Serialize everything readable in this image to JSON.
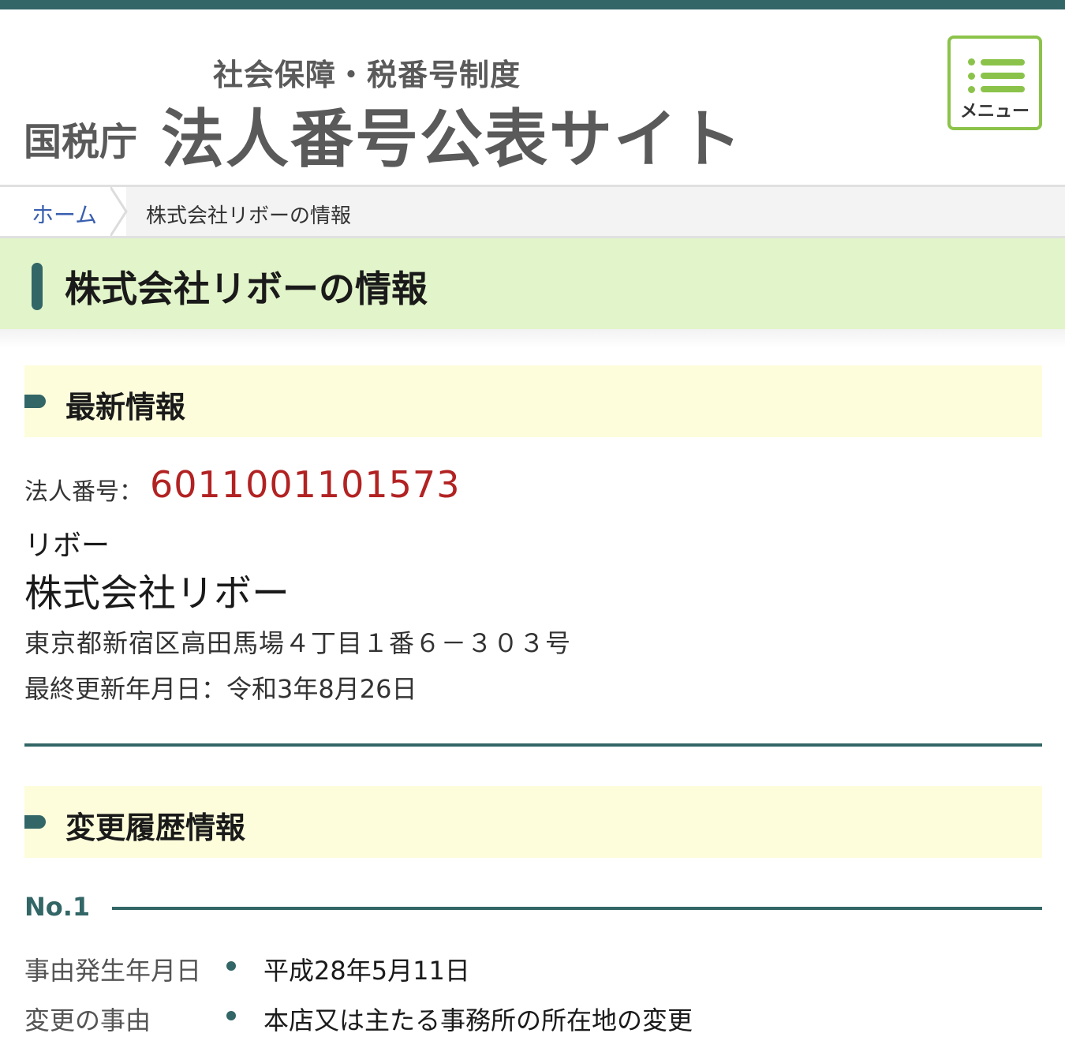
{
  "header": {
    "subtitle": "社会保障・税番号制度",
    "agency": "国税庁",
    "site_title": "法人番号公表サイト",
    "menu_label": "メニュー"
  },
  "breadcrumb": {
    "home": "ホーム",
    "current": "株式会社リボーの情報"
  },
  "page_title": "株式会社リボーの情報",
  "latest": {
    "heading": "最新情報",
    "corp_number_label": "法人番号：",
    "corp_number": "6011001101573",
    "name_kana": "リボー",
    "name": "株式会社リボー",
    "address": "東京都新宿区高田馬場４丁目１番６－３０３号",
    "updated": "最終更新年月日：令和3年8月26日"
  },
  "history": {
    "heading": "変更履歴情報",
    "entries": [
      {
        "no": "No.1",
        "rows": [
          {
            "label": "事由発生年月日",
            "value": "平成28年5月11日"
          },
          {
            "label": "変更の事由",
            "value": "本店又は主たる事務所の所在地の変更"
          }
        ]
      }
    ]
  },
  "colors": {
    "brand_dark": "#336666",
    "accent_green": "#8bc34a",
    "title_band": "#e2f4c9",
    "section_band": "#fdfddc",
    "number_red": "#b22222",
    "link_blue": "#3a5fb0"
  }
}
